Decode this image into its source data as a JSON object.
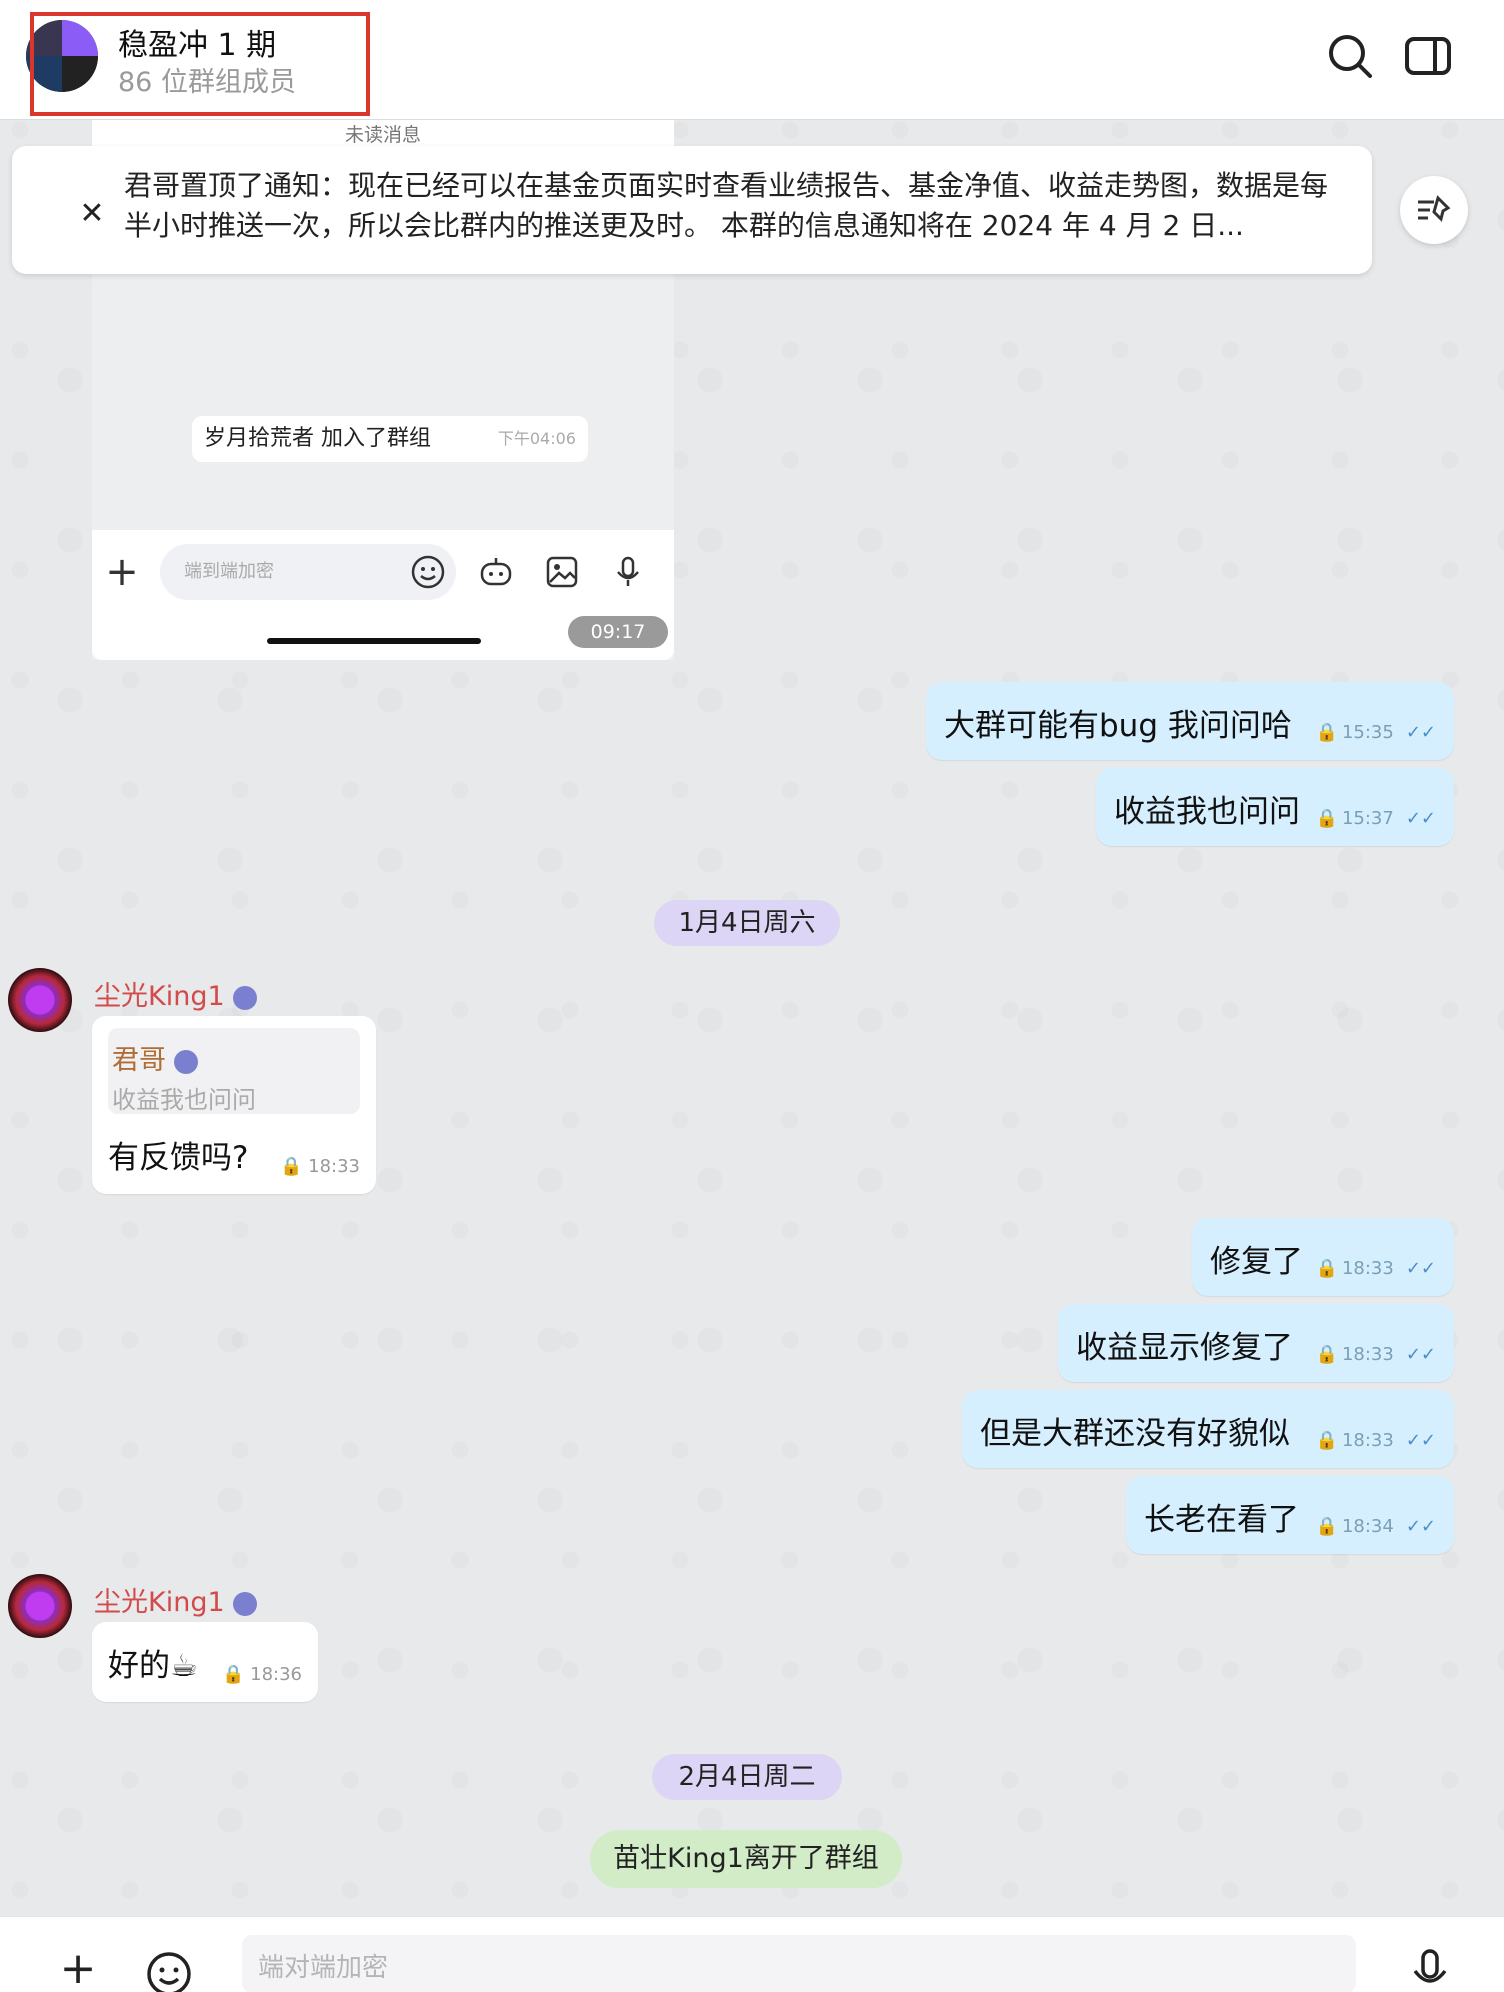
{
  "header": {
    "title": "稳盈冲 1 期",
    "subtitle": "86 位群组成员"
  },
  "embedded": {
    "unread_label": "未读消息",
    "join_text": "岁月拾荒者 加入了群组",
    "join_time": "下午04:06",
    "input_placeholder": "端到端加密",
    "time": "09:17"
  },
  "pinned": {
    "text": "君哥置顶了通知：现在已经可以在基金页面实时查看业绩报告、基金净值、收益走势图，数据是每半小时推送一次，所以会比群内的推送更及时。 本群的信息通知将在 2024 年 4 月 2 日..."
  },
  "messages_out_1": [
    {
      "text": "大群可能有bug 我问问哈",
      "time": "15:35"
    },
    {
      "text": "收益我也问问",
      "time": "15:37"
    }
  ],
  "date_1": "1月4日周六",
  "incoming_1": {
    "sender": "尘光King1",
    "quote_name": "君哥",
    "quote_text": "收益我也问问",
    "text": "有反馈吗?",
    "time": "18:33"
  },
  "messages_out_2": [
    {
      "text": "修复了",
      "time": "18:33"
    },
    {
      "text": "收益显示修复了",
      "time": "18:33"
    },
    {
      "text": "但是大群还没有好貌似",
      "time": "18:33"
    },
    {
      "text": "长老在看了",
      "time": "18:34"
    }
  ],
  "incoming_2": {
    "sender": "尘光King1",
    "text": "好的☕",
    "time": "18:36"
  },
  "date_2": "2月4日周二",
  "system_message": "苗壮King1离开了群组",
  "composer": {
    "placeholder": "端对端加密"
  },
  "colors": {
    "outgoing_bubble": "#d6efff",
    "date_pill": "#dcd5f5",
    "system_pill": "#d2ecc8",
    "sender_name": "#d34a4a",
    "highlight_box": "#d9372b"
  }
}
